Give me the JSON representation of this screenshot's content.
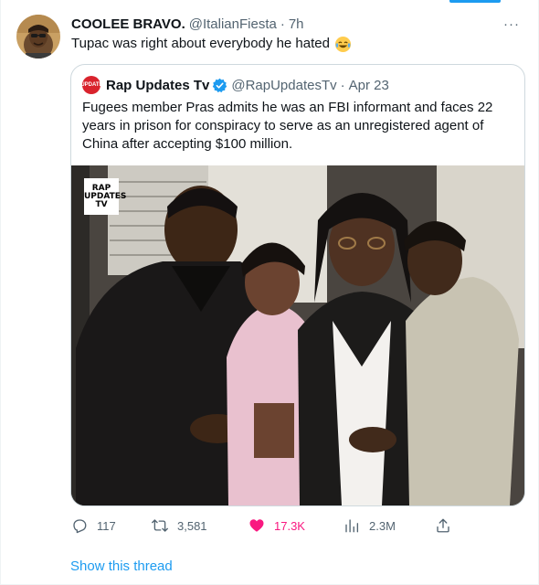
{
  "tweet": {
    "author": {
      "display_name": "COOLEE BRAVO.",
      "handle": "@ItalianFiesta",
      "separator": "·",
      "time": "7h"
    },
    "more_label": "···",
    "text": "Tupac was right about everybody he hated",
    "emoji": "face-with-tears-of-joy"
  },
  "quote": {
    "author": {
      "avatar_text": "RAP UPDATES TV",
      "display_name": "Rap Updates Tv",
      "verified": true,
      "handle": "@RapUpdatesTv",
      "separator": "·",
      "date": "Apr 23"
    },
    "text": "Fugees member Pras admits he was an FBI informant and faces 22 years in prison for conspiracy to serve as an unregistered agent of China after accepting $100 million.",
    "media": {
      "type": "photo",
      "watermark_lines": [
        "RAP",
        "UPDATES",
        "TV"
      ]
    }
  },
  "actions": {
    "replies": "117",
    "retweets": "3,581",
    "likes": "17.3K",
    "liked": true,
    "views": "2.3M"
  },
  "show_thread": "Show this thread",
  "colors": {
    "accent": "#1d9bf0",
    "like": "#f91880",
    "text": "#0f1419",
    "secondary": "#536471",
    "border": "#cfd9de"
  }
}
